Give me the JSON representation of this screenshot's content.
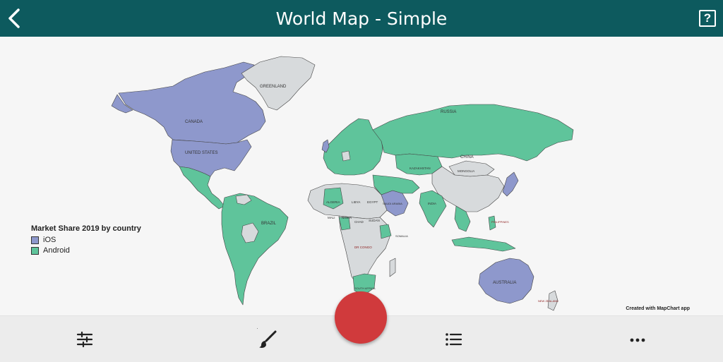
{
  "header": {
    "title": "World Map - Simple",
    "help_glyph": "?",
    "back_icon": "chevron-left-icon",
    "help_icon": "help-box-icon"
  },
  "map": {
    "legend_title": "Market Share 2019 by country",
    "legend": [
      {
        "label": "iOS",
        "color": "#8e98cc"
      },
      {
        "label": "Android",
        "color": "#5fc49b"
      }
    ],
    "unassigned_color": "#d7dadc",
    "country_labels": {
      "greenland": "GREENLAND",
      "canada": "CANADA",
      "united_states": "UNITED STATES",
      "russia": "RUSSIA",
      "china": "CHINA",
      "brazil": "BRAZIL",
      "australia": "AUSTRALIA",
      "mongolia": "MONGOLIA",
      "kazakhstan": "KAZAKHSTAN",
      "algeria": "ALGERIA",
      "libya": "LIBYA",
      "egypt": "EGYPT",
      "niger": "NIGER",
      "chad": "CHAD",
      "sudan": "SUDAN",
      "mali": "MALI",
      "india": "INDIA",
      "saudi_arabia": "SAUDI ARABIA",
      "dr_congo": "DR CONGO",
      "south_africa": "SOUTH AFRICA",
      "new_zealand": "NEW ZEALAND",
      "somalia": "SOMALIA",
      "philippines": "PHILIPPINES"
    },
    "credit": "Created with MapChart app"
  },
  "toolbar": {
    "settings_icon": "sliders-icon",
    "brush_icon": "paint-brush-icon",
    "record_button": "record-button",
    "list_icon": "list-icon",
    "more_icon": "more-horizontal-icon"
  }
}
